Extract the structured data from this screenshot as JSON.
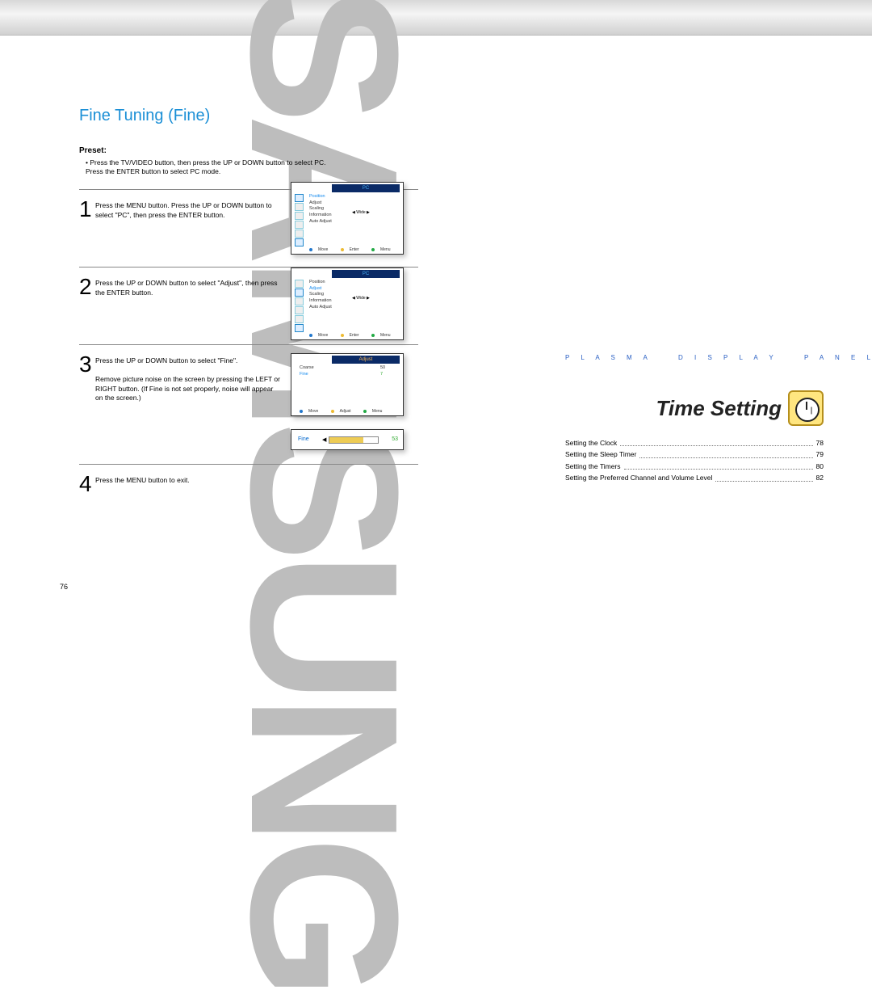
{
  "brand_watermark": "SAMSUNG",
  "left": {
    "title": "Fine Tuning (Fine)",
    "preset_label": "Preset:",
    "preset_body": "• Press the TV/VIDEO button, then press the UP or DOWN button to select PC.\n  Press the ENTER button to select PC mode.",
    "steps": [
      {
        "n": "1",
        "txt": "Press the MENU button. Press the UP or DOWN button to select \"PC\", then press the ENTER button."
      },
      {
        "n": "2",
        "txt": "Press the UP or DOWN button to select \"Adjust\", then press the ENTER button."
      },
      {
        "n": "3",
        "txt": "Press the UP or DOWN button to select \"Fine\".\n\nRemove picture noise on the screen by pressing the LEFT or RIGHT button. (If Fine is not set properly, noise will appear on the screen.)"
      },
      {
        "n": "4",
        "txt": "Press the MENU button to exit."
      }
    ],
    "page_number": "76"
  },
  "osd": {
    "screen1": {
      "title": "PC",
      "items": [
        "Position",
        "Adjust",
        "Scaling",
        "Information",
        "Auto Adjust"
      ],
      "highlight": "Position",
      "wide": "Wide",
      "foot": [
        "Move",
        "Enter",
        "Menu"
      ]
    },
    "screen2": {
      "title": "PC",
      "items": [
        "Position",
        "Adjust",
        "Scaling",
        "Information",
        "Auto Adjust"
      ],
      "highlight": "Adjust",
      "wide": "Wide",
      "foot": [
        "Move",
        "Enter",
        "Menu"
      ]
    },
    "screen3": {
      "title": "Adjust",
      "items": [
        "Coarse",
        "Fine"
      ],
      "values": [
        "50",
        "7"
      ],
      "highlight": "Fine",
      "foot": [
        "Move",
        "Adjust",
        "Menu"
      ]
    },
    "bar": {
      "label": "Fine",
      "value": "53"
    }
  },
  "right": {
    "pdp": {
      "a": "P L A S M A",
      "b": "D I S P L A Y",
      "c": "P A N E L"
    },
    "heading": "Time Setting",
    "toc": [
      {
        "t": "Setting the Clock",
        "p": "78"
      },
      {
        "t": "Setting the Sleep Timer",
        "p": "79"
      },
      {
        "t": "Setting the Timers",
        "p": "80"
      },
      {
        "t": "Setting the Preferred Channel and Volume Level",
        "p": "82"
      }
    ]
  }
}
